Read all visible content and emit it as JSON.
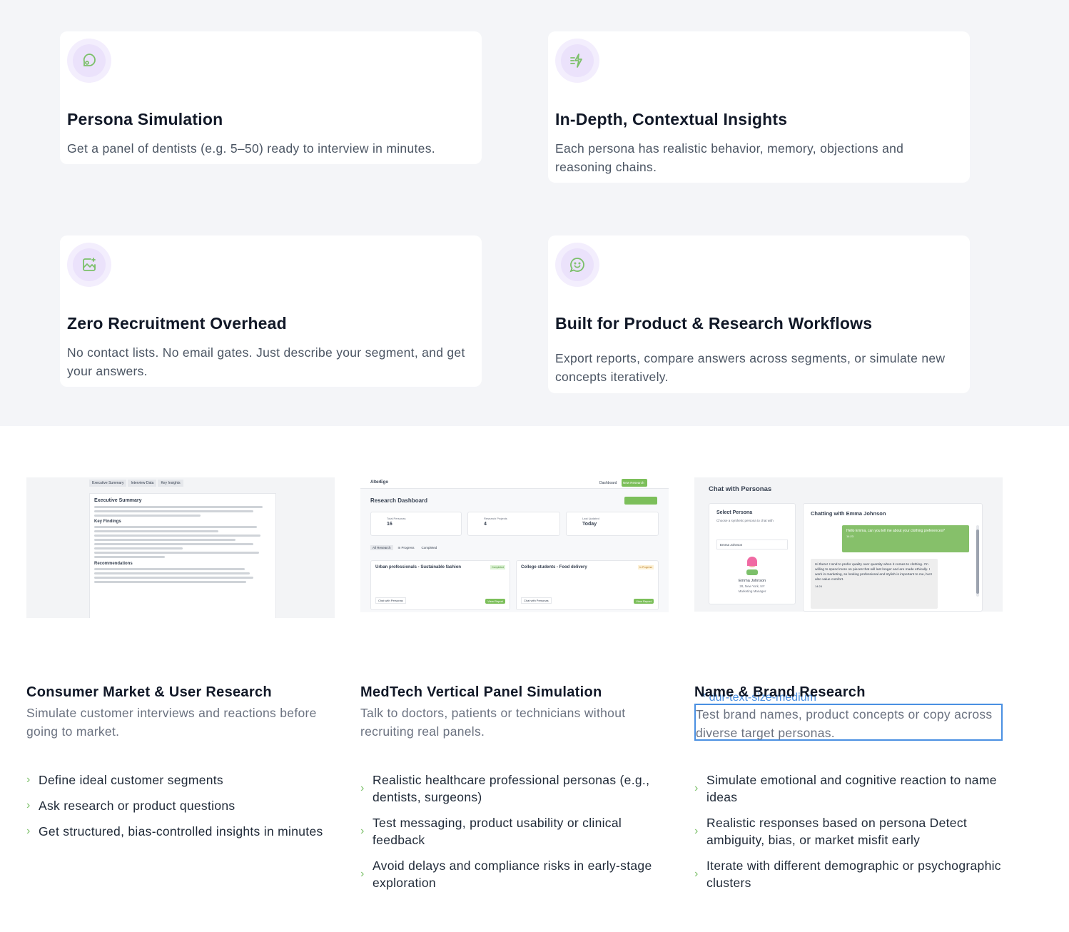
{
  "features": [
    {
      "title": "Persona Simulation",
      "desc": "Get a panel of dentists (e.g. 5–50) ready to interview in minutes.",
      "icon": "chat-bubble-icon"
    },
    {
      "title": "In-Depth, Contextual Insights",
      "desc": "Each persona has realistic behavior, memory, objections and reasoning chains.",
      "icon": "lightning-icon"
    },
    {
      "title": "Zero Recruitment Overhead",
      "desc": "No contact lists. No email gates. Just describe your segment, and get your answers.",
      "icon": "image-sparkle-icon"
    },
    {
      "title": "Built for Product & Research Workflows",
      "desc": "Export reports, compare answers across segments, or simulate new concepts iteratively.",
      "icon": "smile-chat-icon"
    }
  ],
  "use_cases": [
    {
      "title": "Consumer Market & User Research",
      "desc": "Simulate customer interviews and reactions before going to market.",
      "bullets": [
        "Define ideal customer segments",
        "Ask research or product questions",
        "Get structured, bias-controlled insights in minutes"
      ],
      "shot": {
        "tabs": [
          "Executive Summary",
          "Interview Data",
          "Key Insights"
        ],
        "heading": "Executive Summary",
        "sub1": "Key Findings",
        "sub2": "Recommendations"
      }
    },
    {
      "title": "MedTech Vertical Panel Simulation",
      "desc": "Talk to doctors, patients or technicians without recruiting real panels.",
      "bullets": [
        "Realistic healthcare professional personas (e.g., dentists, surgeons)",
        "Test messaging, product usability or clinical feedback",
        "Avoid delays and compliance risks in early-stage exploration"
      ],
      "shot": {
        "brand": "AlterEgo",
        "nav": "Dashboard",
        "new_btn": "New Research",
        "heading": "Research Dashboard",
        "stat1_label": "Total Personas",
        "stat1_value": "16",
        "stat2_label": "Research Projects",
        "stat2_value": "4",
        "stat3_label": "Last Updated",
        "stat3_value": "Today",
        "filters": [
          "All Research",
          "In Progress",
          "Completed"
        ],
        "proj1": "Urban professionals - Sustainable fashion",
        "proj2": "College students - Food delivery",
        "proj1_badge": "Completed",
        "proj2_badge": "In Progress",
        "chat_btn": "Chat with Personas",
        "report_btn": "View Report"
      }
    },
    {
      "title": "Name & Brand Research",
      "desc": "Test brand names, product concepts or copy across diverse target personas.",
      "ghost": "* dur-text-size-medium",
      "bullets": [
        "Simulate emotional and cognitive reaction to name ideas",
        "Realistic responses based on persona Detect ambiguity, bias, or market misfit early",
        "Iterate with different demographic or psychographic clusters"
      ],
      "shot": {
        "heading": "Chat with Personas",
        "select_title": "Select Persona",
        "select_sub": "Choose a synthetic persona to chat with",
        "select_value": "Emma Johnson",
        "persona_name": "Emma Johnson",
        "persona_meta1": "28, New York, NY",
        "persona_meta2": "Marketing Manager",
        "chat_title": "Chatting with Emma Johnson",
        "msg_user": "Hello Emma, can you tell me about your clothing preferences?",
        "msg_user_time": "14:23",
        "msg_bot": "Hi there! I tend to prefer quality over quantity when it comes to clothing. I'm willing to spend more on pieces that will last longer and are made ethically. I work in marketing, so looking professional and stylish is important to me, but I also value comfort.",
        "msg_bot_time": "14:24"
      }
    }
  ],
  "colors": {
    "accent_green": "#7cc06a",
    "icon_bg": "#f3eefd",
    "page_bg": "#f4f5f8",
    "focus_blue": "#4a90e2"
  }
}
